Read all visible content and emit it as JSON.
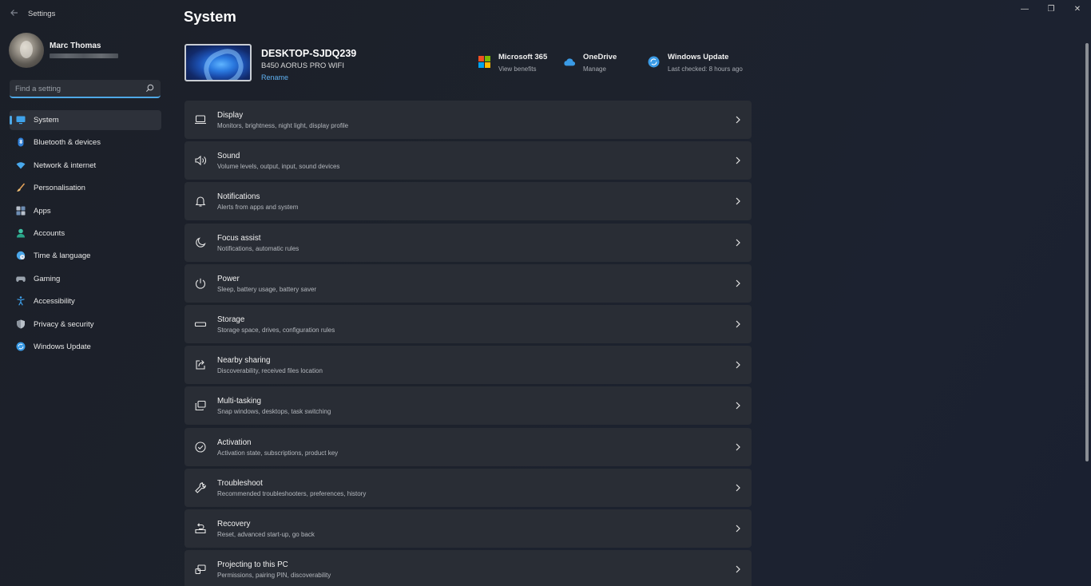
{
  "window": {
    "app_title": "Settings",
    "controls": {
      "minimize": "—",
      "restore": "❐",
      "close": "✕"
    }
  },
  "user": {
    "name": "Marc Thomas"
  },
  "search": {
    "placeholder": "Find a setting",
    "value": ""
  },
  "sidebar": {
    "items": [
      {
        "label": "System",
        "icon": "monitor-icon",
        "active": true
      },
      {
        "label": "Bluetooth & devices",
        "icon": "bluetooth-icon"
      },
      {
        "label": "Network & internet",
        "icon": "wifi-icon"
      },
      {
        "label": "Personalisation",
        "icon": "brush-icon"
      },
      {
        "label": "Apps",
        "icon": "apps-icon"
      },
      {
        "label": "Accounts",
        "icon": "person-icon"
      },
      {
        "label": "Time & language",
        "icon": "globe-clock-icon"
      },
      {
        "label": "Gaming",
        "icon": "gamepad-icon"
      },
      {
        "label": "Accessibility",
        "icon": "accessibility-icon"
      },
      {
        "label": "Privacy & security",
        "icon": "shield-icon"
      },
      {
        "label": "Windows Update",
        "icon": "update-icon"
      }
    ]
  },
  "main": {
    "title": "System",
    "device": {
      "name": "DESKTOP-SJDQ239",
      "model": "B450 AORUS PRO WIFI",
      "rename_label": "Rename"
    },
    "quick_links": [
      {
        "title": "Microsoft 365",
        "subtitle": "View benefits",
        "icon": "microsoft-logo-icon"
      },
      {
        "title": "OneDrive",
        "subtitle": "Manage",
        "icon": "cloud-icon"
      },
      {
        "title": "Windows Update",
        "subtitle": "Last checked: 8 hours ago",
        "icon": "update-icon"
      }
    ],
    "settings": [
      {
        "title": "Display",
        "subtitle": "Monitors, brightness, night light, display profile",
        "icon": "laptop-icon"
      },
      {
        "title": "Sound",
        "subtitle": "Volume levels, output, input, sound devices",
        "icon": "speaker-icon"
      },
      {
        "title": "Notifications",
        "subtitle": "Alerts from apps and system",
        "icon": "bell-icon"
      },
      {
        "title": "Focus assist",
        "subtitle": "Notifications, automatic rules",
        "icon": "moon-icon"
      },
      {
        "title": "Power",
        "subtitle": "Sleep, battery usage, battery saver",
        "icon": "power-icon"
      },
      {
        "title": "Storage",
        "subtitle": "Storage space, drives, configuration rules",
        "icon": "storage-icon"
      },
      {
        "title": "Nearby sharing",
        "subtitle": "Discoverability, received files location",
        "icon": "share-icon"
      },
      {
        "title": "Multi-tasking",
        "subtitle": "Snap windows, desktops, task switching",
        "icon": "multitask-icon"
      },
      {
        "title": "Activation",
        "subtitle": "Activation state, subscriptions, product key",
        "icon": "check-circle-icon"
      },
      {
        "title": "Troubleshoot",
        "subtitle": "Recommended troubleshooters, preferences, history",
        "icon": "wrench-icon"
      },
      {
        "title": "Recovery",
        "subtitle": "Reset, advanced start-up, go back",
        "icon": "recovery-icon"
      },
      {
        "title": "Projecting to this PC",
        "subtitle": "Permissions, pairing PIN, discoverability",
        "icon": "projector-icon"
      }
    ]
  },
  "colors": {
    "accent": "#4ea8e6",
    "card": "#292d35",
    "background": "#1c2029"
  }
}
